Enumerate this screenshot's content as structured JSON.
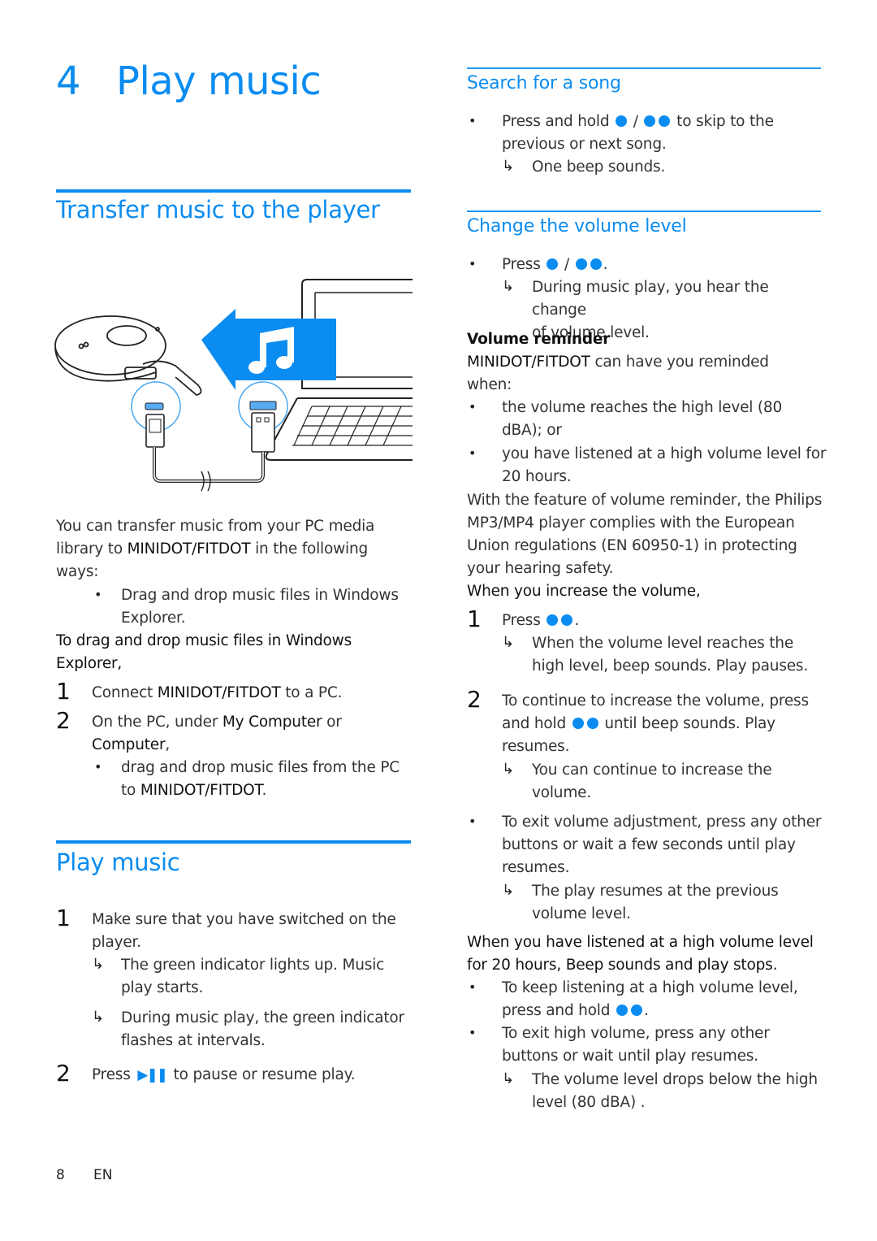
{
  "chapter": {
    "number": "4",
    "title": "Play music"
  },
  "left": {
    "transfer": {
      "heading": "Transfer music to the player",
      "intro_lines": [
        "You can transfer music from your PC media",
        "library to ",
        "MINIDOT/FITDOT",
        " in the following",
        "ways:"
      ],
      "bullet1_lines": [
        "Drag and drop music files in Windows",
        "Explorer."
      ],
      "subhead_lines": [
        "To drag and drop music files in Windows",
        "Explorer,"
      ],
      "steps": [
        {
          "num": "1",
          "pre": "Connect ",
          "em": "MINIDOT/FITDOT",
          "post": " to a PC."
        },
        {
          "num": "2",
          "pre": "On the PC, under ",
          "em": "My Computer",
          "post": " or",
          "line2": "Computer",
          "line2_post": ","
        }
      ],
      "sub_bullet_lines": [
        " drag and drop music files from the PC",
        "to ",
        "MINIDOT/FITDOT",
        "."
      ]
    },
    "play": {
      "heading": "Play music",
      "step1_num": "1",
      "step1_lines": [
        "Make sure that you have switched on the",
        "player."
      ],
      "result1_lines": [
        "The green indicator lights up. Music",
        "play starts."
      ],
      "result2_lines": [
        "During music play, the green indicator",
        "flashes at intervals."
      ],
      "step2_num": "2",
      "step2_pre": "Press ",
      "step2_icon": "play-pause-icon",
      "step2_post": " to pause or resume play."
    },
    "illustration": {
      "description": "Player connected via USB cable to laptop; blue arrow with music note pointing from laptop to player",
      "accent": "#0a8cf0"
    }
  },
  "right": {
    "search": {
      "heading": "Search for a song",
      "bullet_pre": "Press and hold ",
      "bullet_mid": " / ",
      "bullet_post": " to skip to the",
      "bullet_line2": "previous or next song.",
      "result": "One beep sounds."
    },
    "volume": {
      "heading": "Change the volume level",
      "bullet_pre": "Press ",
      "bullet_mid": " / ",
      "bullet_post": ".",
      "result_lines": [
        "During music play, you hear the change",
        "of volume level."
      ],
      "reminder_title": "Volume reminder",
      "reminder_brand": "MINIDOT/FITDOT",
      "reminder_text1": " can have you reminded",
      "reminder_text2": "when:",
      "reminder_bullets": [
        [
          "the volume reaches the high level (80",
          "dBA); or"
        ],
        [
          "you have listened at a high volume level for",
          "20 hours."
        ]
      ],
      "feature_lines": [
        "With the feature of volume reminder, the Philips",
        "MP3/MP4 player complies with the European",
        "Union regulations (EN 60950-1) in protecting",
        "your hearing safety."
      ],
      "increase_head": "When you increase the volume,",
      "inc_step1_num": "1",
      "inc_step1_pre": "Press ",
      "inc_step1_post": ".",
      "inc_result1_lines": [
        "When the volume level reaches the",
        "high level, beep sounds. Play pauses."
      ],
      "inc_step2_num": "2",
      "inc_step2_line1": "To continue to increase the volume, press",
      "inc_step2_pre": "and hold ",
      "inc_step2_post": " until beep sounds. Play",
      "inc_step2_line3": "resumes.",
      "inc_result2_lines": [
        "You can continue to increase the",
        "volume."
      ],
      "exit_bullet_lines": [
        "To exit volume adjustment, press any other",
        "buttons or wait a few seconds until play",
        "resumes."
      ],
      "exit_result_lines": [
        "The play resumes at the previous",
        "volume level."
      ],
      "twenty_head_lines": [
        "When you have listened at a high volume level",
        "for 20 hours, Beep sounds and play stops."
      ],
      "keep_pre": "To keep listening at a high volume level,",
      "keep_line2_pre": "press and hold ",
      "keep_line2_post": ".",
      "exit_high_lines": [
        "To exit high volume, press any other",
        "buttons or wait until play resumes."
      ],
      "exit_high_result_lines": [
        "The volume level drops below the high",
        "level (80 dBA) ."
      ]
    }
  },
  "footer": {
    "page": "8",
    "lang": "EN"
  },
  "symbols": {
    "bullet": "•",
    "arrow": "↳"
  }
}
